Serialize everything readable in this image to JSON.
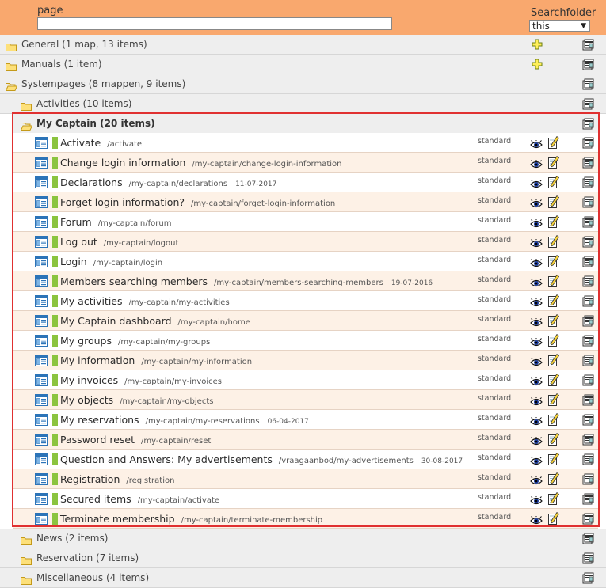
{
  "header": {
    "page_label": "page",
    "page_value": "",
    "searchfolder_label": "Searchfolder",
    "searchfolder_value": "this"
  },
  "folders_top": [
    {
      "label": "General (1 map, 13 items)",
      "open": false,
      "has_add": true
    },
    {
      "label": "Manuals (1 item)",
      "open": false,
      "has_add": true
    },
    {
      "label": "Systempages (8 mappen, 9 items)",
      "open": true,
      "has_add": false
    },
    {
      "label": "Activities (10 items)",
      "open": false,
      "has_add": false
    }
  ],
  "current_folder": {
    "label": "My Captain (20 items)",
    "open": true
  },
  "items": [
    {
      "title": "Activate",
      "path": "/activate",
      "date": "",
      "status": "standard"
    },
    {
      "title": "Change login information",
      "path": "/my-captain/change-login-information",
      "date": "",
      "status": "standard"
    },
    {
      "title": "Declarations",
      "path": "/my-captain/declarations",
      "date": "11-07-2017",
      "status": "standard"
    },
    {
      "title": "Forget login information?",
      "path": "/my-captain/forget-login-information",
      "date": "",
      "status": "standard"
    },
    {
      "title": "Forum",
      "path": "/my-captain/forum",
      "date": "",
      "status": "standard"
    },
    {
      "title": "Log out",
      "path": "/my-captain/logout",
      "date": "",
      "status": "standard"
    },
    {
      "title": "Login",
      "path": "/my-captain/login",
      "date": "",
      "status": "standard"
    },
    {
      "title": "Members searching members",
      "path": "/my-captain/members-searching-members",
      "date": "19-07-2016",
      "status": "standard"
    },
    {
      "title": "My activities",
      "path": "/my-captain/my-activities",
      "date": "",
      "status": "standard"
    },
    {
      "title": "My Captain dashboard",
      "path": "/my-captain/home",
      "date": "",
      "status": "standard"
    },
    {
      "title": "My groups",
      "path": "/my-captain/my-groups",
      "date": "",
      "status": "standard"
    },
    {
      "title": "My information",
      "path": "/my-captain/my-information",
      "date": "",
      "status": "standard"
    },
    {
      "title": "My invoices",
      "path": "/my-captain/my-invoices",
      "date": "",
      "status": "standard"
    },
    {
      "title": "My objects",
      "path": "/my-captain/my-objects",
      "date": "",
      "status": "standard"
    },
    {
      "title": "My reservations",
      "path": "/my-captain/my-reservations",
      "date": "06-04-2017",
      "status": "standard"
    },
    {
      "title": "Password reset",
      "path": "/my-captain/reset",
      "date": "",
      "status": "standard"
    },
    {
      "title": "Question and Answers: My advertisements",
      "path": "/vraagaanbod/my-advertisements",
      "date": "30-08-2017",
      "status": "standard"
    },
    {
      "title": "Registration",
      "path": "/registration",
      "date": "",
      "status": "standard"
    },
    {
      "title": "Secured items",
      "path": "/my-captain/activate",
      "date": "",
      "status": "standard"
    },
    {
      "title": "Terminate membership",
      "path": "/my-captain/terminate-membership",
      "date": "",
      "status": "standard"
    }
  ],
  "folders_bottom": [
    {
      "label": "News (2 items)",
      "open": false
    },
    {
      "label": "Reservation (7 items)",
      "open": false
    },
    {
      "label": "Miscellaneous (4 items)",
      "open": false
    }
  ],
  "colors": {
    "header_bg": "#f9a86e",
    "frame": "#e03030",
    "status_bar": "#8bc43f",
    "row_alt": "#fdf1e6",
    "folder_row": "#eeeeee"
  }
}
